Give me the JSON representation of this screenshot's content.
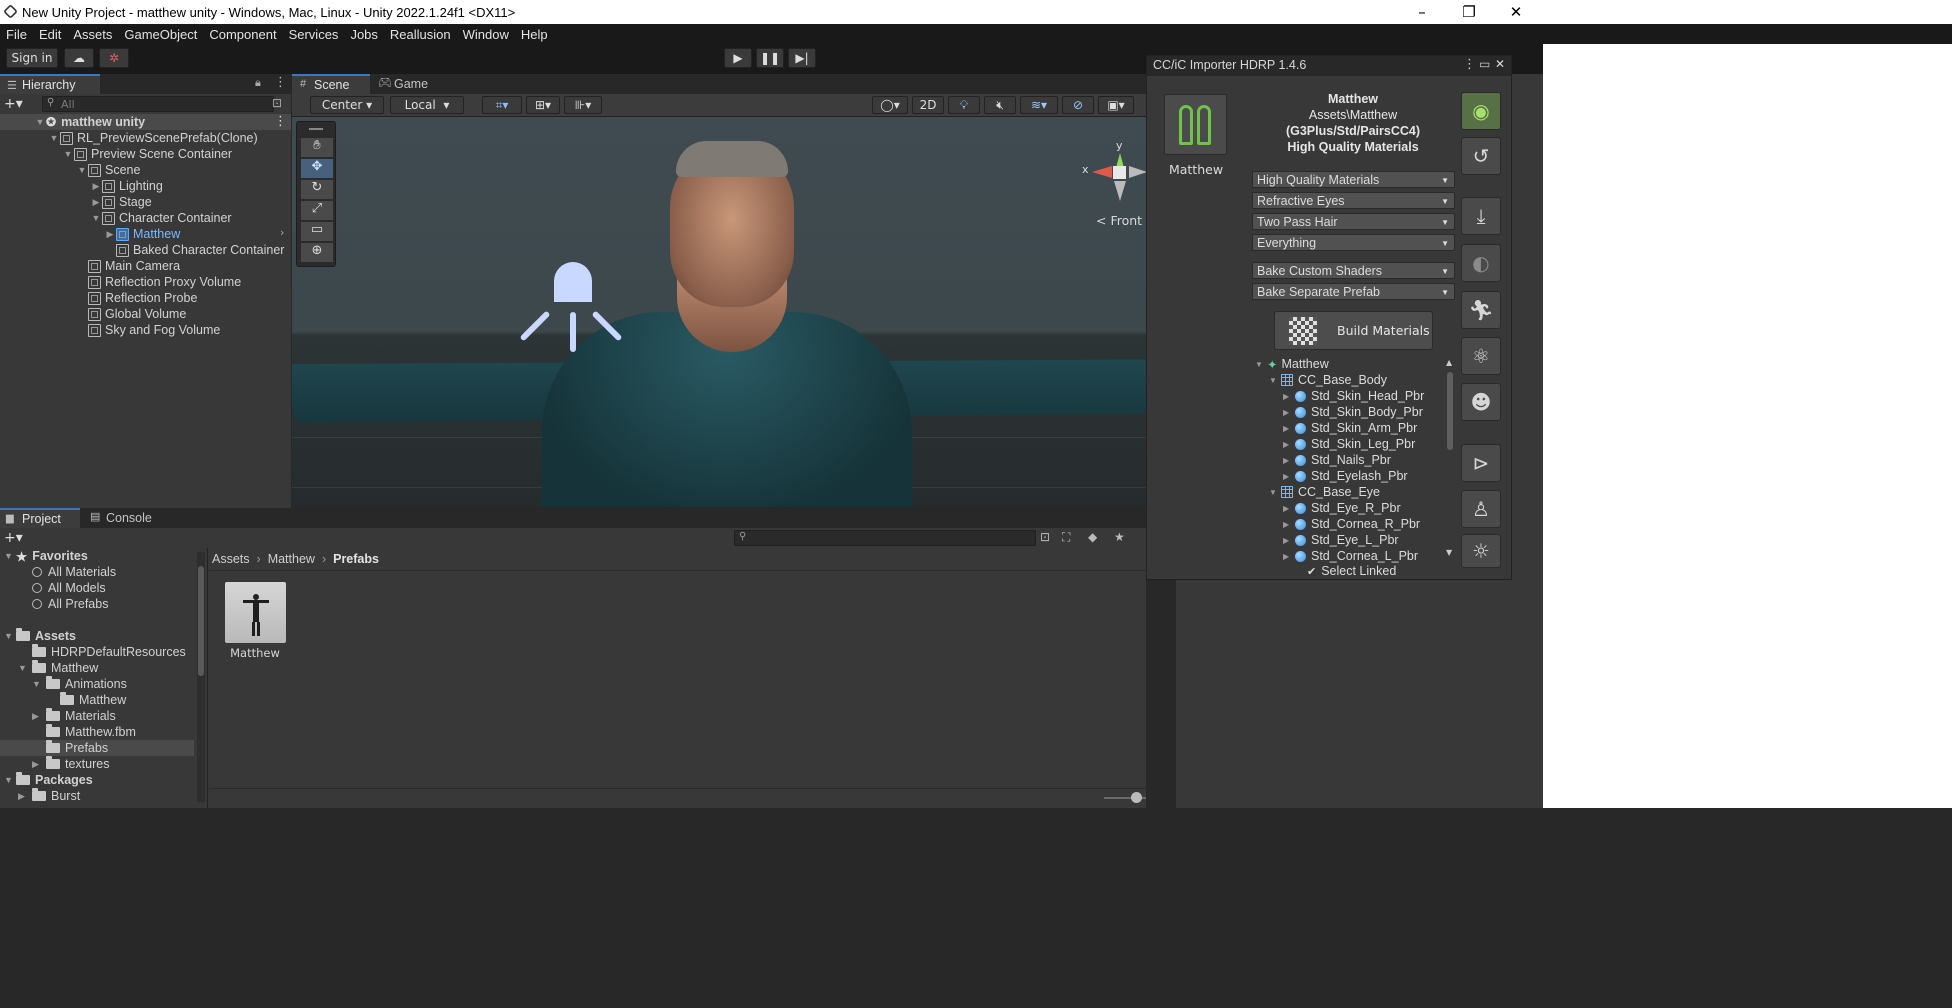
{
  "window": {
    "title": "New Unity Project - matthew unity - Windows, Mac, Linux - Unity 2022.1.24f1 <DX11>",
    "minimize": "–",
    "maximize": "❐",
    "close": "✕"
  },
  "menu": [
    "File",
    "Edit",
    "Assets",
    "GameObject",
    "Component",
    "Services",
    "Jobs",
    "Reallusion",
    "Window",
    "Help"
  ],
  "toolbar": {
    "sign_in": "Sign in"
  },
  "hierarchy": {
    "tab": "Hierarchy",
    "search_placeholder": "All",
    "rows": [
      {
        "label": "matthew unity",
        "indent": 0
      },
      {
        "label": "RL_PreviewScenePrefab(Clone)",
        "indent": 1
      },
      {
        "label": "Preview Scene Container",
        "indent": 2
      },
      {
        "label": "Scene",
        "indent": 3
      },
      {
        "label": "Lighting",
        "indent": 4
      },
      {
        "label": "Stage",
        "indent": 4
      },
      {
        "label": "Character Container",
        "indent": 4
      },
      {
        "label": "Matthew",
        "indent": 5
      },
      {
        "label": "Baked Character Container",
        "indent": 5
      },
      {
        "label": "Main Camera",
        "indent": 3
      },
      {
        "label": "Reflection Proxy Volume",
        "indent": 3
      },
      {
        "label": "Reflection Probe",
        "indent": 3
      },
      {
        "label": "Global Volume",
        "indent": 3
      },
      {
        "label": "Sky and Fog Volume",
        "indent": 3
      }
    ]
  },
  "scene": {
    "tabs": [
      "Scene",
      "Game"
    ],
    "pivot": "Center",
    "space": "Local",
    "mode_2d": "2D",
    "gizmo_view": "Front",
    "gizmo_x": "x",
    "gizmo_y": "y"
  },
  "project": {
    "tabs": [
      "Project",
      "Console"
    ],
    "favorites_label": "Favorites",
    "favorites": [
      "All Materials",
      "All Models",
      "All Prefabs"
    ],
    "assets_label": "Assets",
    "tree": [
      {
        "label": "HDRPDefaultResources",
        "indent": 1
      },
      {
        "label": "Matthew",
        "indent": 1
      },
      {
        "label": "Animations",
        "indent": 2
      },
      {
        "label": "Matthew",
        "indent": 3
      },
      {
        "label": "Materials",
        "indent": 2
      },
      {
        "label": "Matthew.fbm",
        "indent": 2
      },
      {
        "label": "Prefabs",
        "indent": 2
      },
      {
        "label": "textures",
        "indent": 2
      }
    ],
    "packages_label": "Packages",
    "packages": [
      "Burst"
    ],
    "breadcrumb": [
      "Assets",
      "Matthew",
      "Prefabs"
    ],
    "asset_name": "Matthew"
  },
  "importer": {
    "title": "CC/iC Importer HDRP 1.4.6",
    "character_name": "Matthew",
    "info_name": "Matthew",
    "info_path": "Assets\\Matthew",
    "info_generation": "(G3Plus/Std/PairsCC4)",
    "info_quality": "High Quality Materials",
    "dropdowns": [
      "High Quality Materials",
      "Refractive Eyes",
      "Two Pass Hair",
      "Everything"
    ],
    "bake_dropdowns": [
      "Bake Custom Shaders",
      "Bake Separate Prefab"
    ],
    "build_button": "Build Materials",
    "tree": [
      {
        "label": "Matthew",
        "type": "root"
      },
      {
        "label": "CC_Base_Body",
        "type": "mesh"
      },
      {
        "label": "Std_Skin_Head_Pbr",
        "type": "mat"
      },
      {
        "label": "Std_Skin_Body_Pbr",
        "type": "mat"
      },
      {
        "label": "Std_Skin_Arm_Pbr",
        "type": "mat"
      },
      {
        "label": "Std_Skin_Leg_Pbr",
        "type": "mat"
      },
      {
        "label": "Std_Nails_Pbr",
        "type": "mat"
      },
      {
        "label": "Std_Eyelash_Pbr",
        "type": "mat"
      },
      {
        "label": "CC_Base_Eye",
        "type": "mesh"
      },
      {
        "label": "Std_Eye_R_Pbr",
        "type": "mat"
      },
      {
        "label": "Std_Cornea_R_Pbr",
        "type": "mat"
      },
      {
        "label": "Std_Eye_L_Pbr",
        "type": "mat"
      },
      {
        "label": "Std_Cornea_L_Pbr",
        "type": "mat"
      }
    ],
    "select_linked": "Select Linked"
  }
}
